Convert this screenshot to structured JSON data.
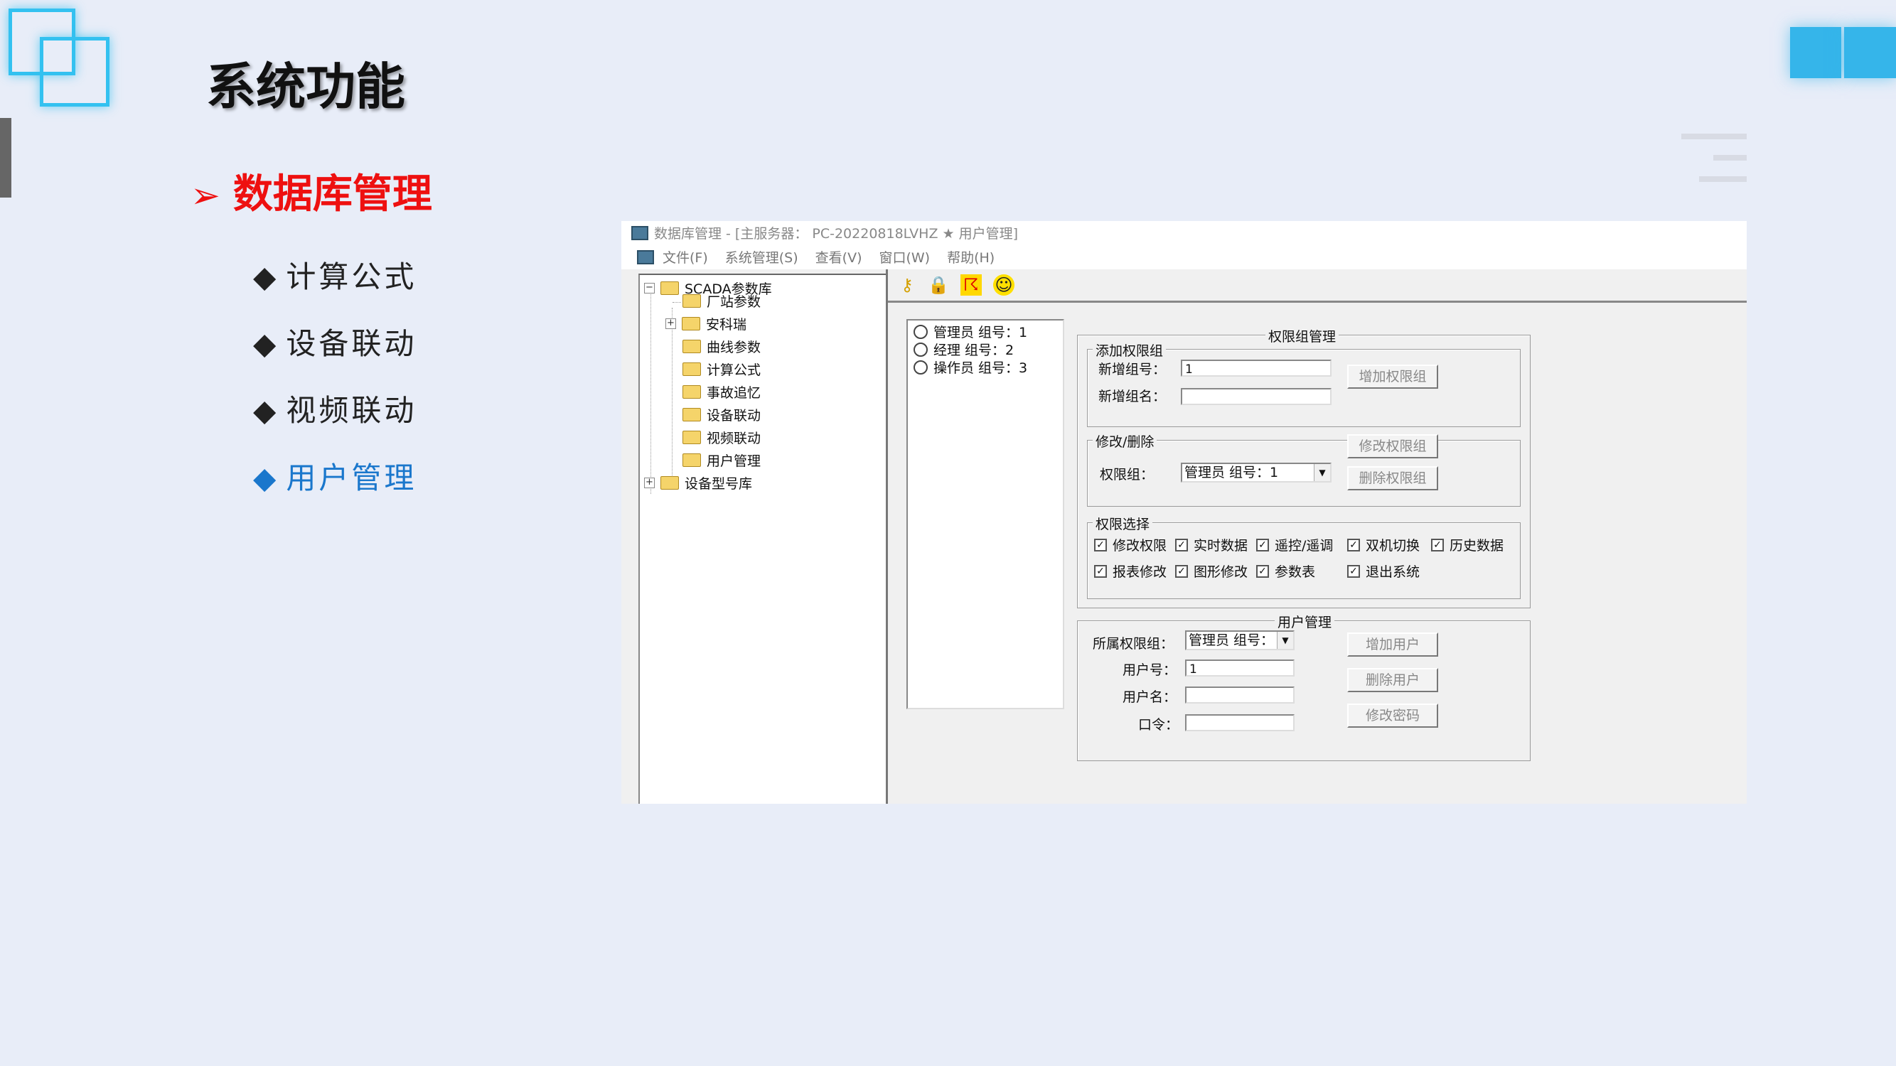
{
  "slide": {
    "title": "系统功能",
    "section": "数据库管理",
    "bullets": [
      "计算公式",
      "设备联动",
      "视频联动",
      "用户管理"
    ]
  },
  "colors": {
    "accent": "#33c1f0",
    "section": "#ee1010",
    "active_bullet": "#1a77cc"
  },
  "window": {
    "title": "数据库管理 - [主服务器： PC-20220818LVHZ ★ 用户管理]",
    "menu": [
      "文件(F)",
      "系统管理(S)",
      "查看(V)",
      "窗口(W)",
      "帮助(H)"
    ],
    "toolbar_icons": [
      "key-icon",
      "lock-icon",
      "running-man-icon",
      "smiley-icon"
    ],
    "tree": {
      "root": "SCADA参数库",
      "children": [
        "厂站参数",
        "安科瑞",
        "曲线参数",
        "计算公式",
        "事故追忆",
        "设备联动",
        "视频联动",
        "用户管理"
      ],
      "root2": "设备型号库"
    },
    "groups": [
      "管理员 组号：1",
      "经理 组号：2",
      "操作员 组号：3"
    ],
    "perm_group_mgmt": {
      "title": "权限组管理",
      "add_title": "添加权限组",
      "new_id_label": "新增组号：",
      "new_id_value": "1",
      "new_name_label": "新增组名：",
      "new_name_value": "",
      "add_button": "增加权限组",
      "modify_title": "修改/删除",
      "group_label": "权限组：",
      "group_value": "管理员 组号：1",
      "modify_button": "修改权限组",
      "delete_button": "删除权限组",
      "perm_title": "权限选择",
      "perms_row1": [
        "修改权限",
        "实时数据",
        "遥控/遥调",
        "双机切换",
        "历史数据"
      ],
      "perms_row2": [
        "报表修改",
        "图形修改",
        "参数表",
        "退出系统"
      ]
    },
    "user_mgmt": {
      "title": "用户管理",
      "group_label": "所属权限组：",
      "group_value": "管理员 组号：",
      "user_id_label": "用户号：",
      "user_id_value": "1",
      "user_name_label": "用户名：",
      "user_name_value": "",
      "password_label": "口令：",
      "password_value": "",
      "add_button": "增加用户",
      "delete_button": "删除用户",
      "change_pw_button": "修改密码"
    }
  }
}
